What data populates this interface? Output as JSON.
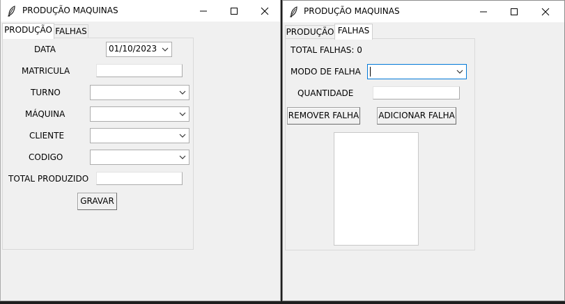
{
  "left_window": {
    "title": "PRODUÇÃO MAQUINAS",
    "tabs": [
      {
        "label": "PRODUÇÃO",
        "active": true
      },
      {
        "label": "FALHAS",
        "active": false
      }
    ],
    "form": {
      "data_label": "DATA",
      "data_value": "01/10/2023",
      "matricula_label": "MATRICULA",
      "turno_label": "TURNO",
      "maquina_label": "MÁQUINA",
      "cliente_label": "CLIENTE",
      "codigo_label": "CODIGO",
      "total_label": "TOTAL PRODUZIDO",
      "gravar_label": "GRAVAR"
    }
  },
  "right_window": {
    "title": "PRODUÇÃO MAQUINAS",
    "tabs": [
      {
        "label": "PRODUÇÃO",
        "active": false
      },
      {
        "label": "FALHAS",
        "active": true
      }
    ],
    "form": {
      "total_falhas": "TOTAL FALHAS: 0",
      "modo_label": "MODO DE FALHA",
      "quantidade_label": "QUANTIDADE",
      "remover_label": "REMOVER FALHA",
      "adicionar_label": "ADICIONAR FALHA"
    }
  },
  "icons": {
    "app": "feather-icon",
    "minimize": "minimize-icon",
    "maximize": "maximize-icon",
    "close": "close-icon",
    "dropdown": "chevron-down-icon"
  },
  "colors": {
    "focus_border": "#0078d7",
    "window_bg": "#f0f0f0",
    "titlebar_bg": "#ffffff"
  }
}
